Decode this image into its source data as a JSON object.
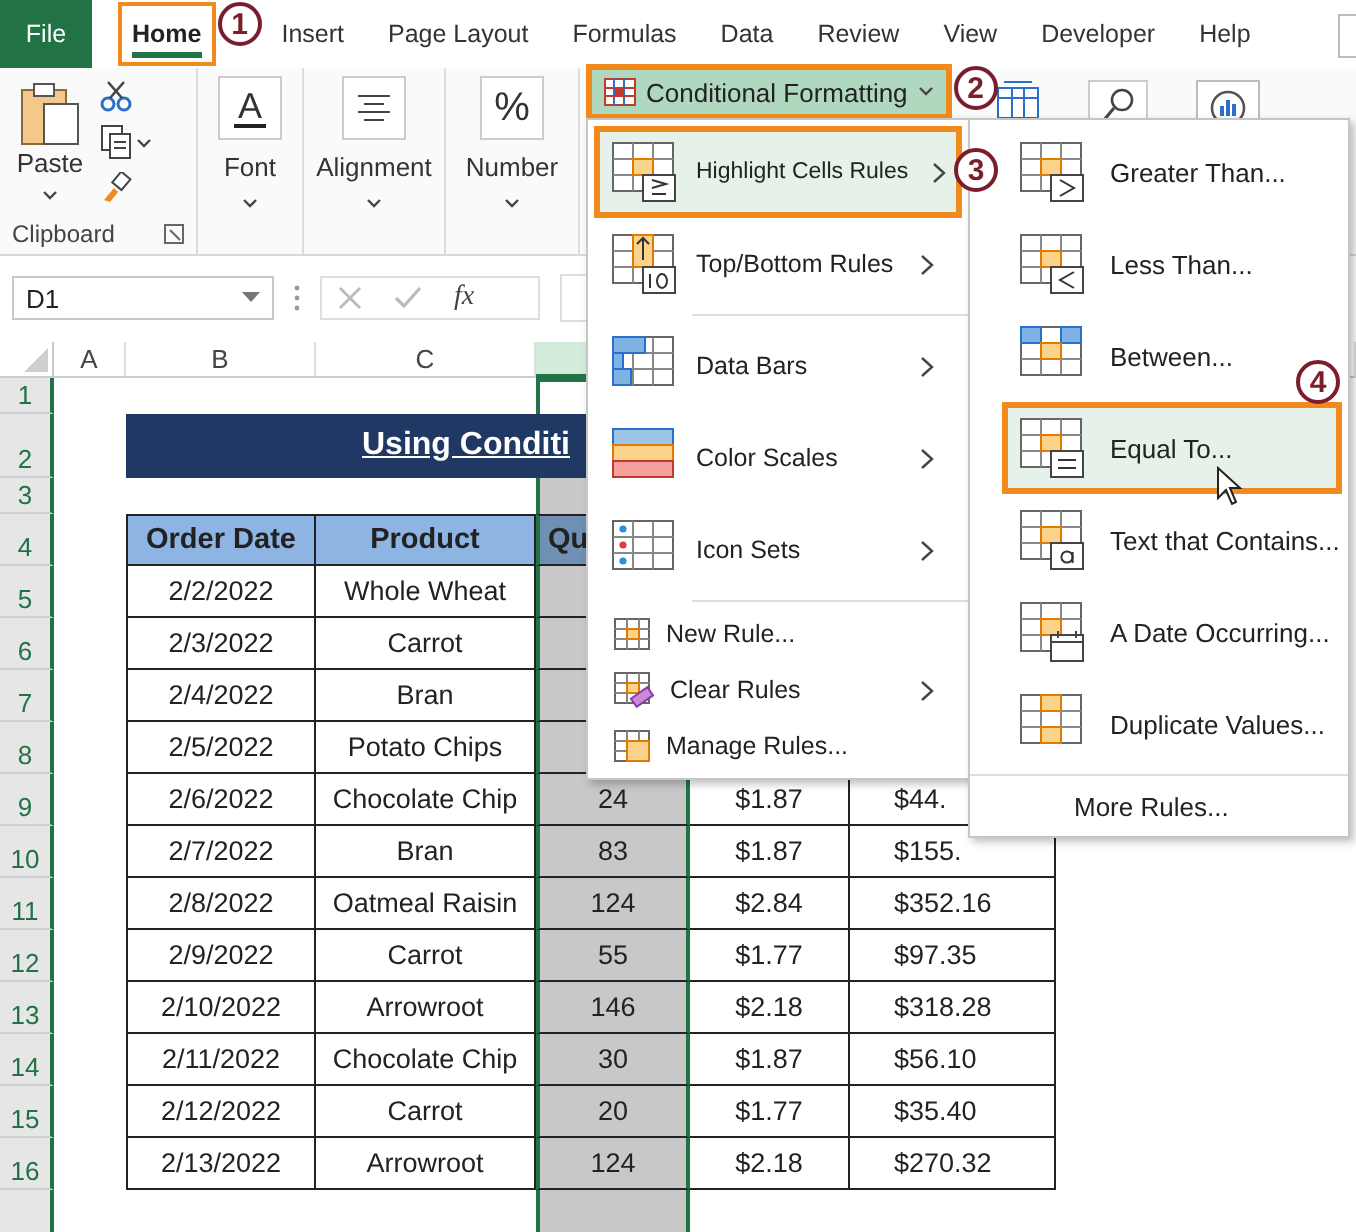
{
  "ribbon_tabs": [
    {
      "label": "File",
      "kind": "file",
      "selected": false,
      "highlighted": false
    },
    {
      "label": "Home",
      "kind": "tab",
      "selected": true,
      "highlighted": true,
      "callout": "1"
    },
    {
      "label": "Insert",
      "kind": "tab",
      "selected": false,
      "highlighted": false
    },
    {
      "label": "Page Layout",
      "kind": "tab",
      "selected": false,
      "highlighted": false
    },
    {
      "label": "Formulas",
      "kind": "tab",
      "selected": false,
      "highlighted": false
    },
    {
      "label": "Data",
      "kind": "tab",
      "selected": false,
      "highlighted": false
    },
    {
      "label": "Review",
      "kind": "tab",
      "selected": false,
      "highlighted": false
    },
    {
      "label": "View",
      "kind": "tab",
      "selected": false,
      "highlighted": false
    },
    {
      "label": "Developer",
      "kind": "tab",
      "selected": false,
      "highlighted": false
    },
    {
      "label": "Help",
      "kind": "tab",
      "selected": false,
      "highlighted": false
    }
  ],
  "ribbon_groups": [
    {
      "kind": "clipboard",
      "button": "Paste",
      "label": "Clipboard"
    },
    {
      "kind": "font",
      "glyph": "A",
      "button": "Font"
    },
    {
      "kind": "alignment",
      "button": "Alignment"
    },
    {
      "kind": "number",
      "glyph": "%",
      "button": "Number"
    }
  ],
  "conditional_formatting": {
    "label": "Conditional Formatting",
    "highlighted": true,
    "callout": "2"
  },
  "formula_bar": {
    "name_box": "D1",
    "function_glyph": "fx"
  },
  "sheet": {
    "column_letters": [
      {
        "label": "A",
        "selected": false
      },
      {
        "label": "B",
        "selected": false
      },
      {
        "label": "C",
        "selected": false
      },
      {
        "selected": true
      }
    ],
    "row_numbers": [
      "1",
      "2",
      "3",
      "4",
      "5",
      "6",
      "7",
      "8",
      "9",
      "10",
      "11",
      "12",
      "13",
      "14",
      "15",
      "16"
    ],
    "title": "Using Conditi",
    "table": {
      "headers": [
        "Order Date",
        "Product",
        "Qu"
      ],
      "rows": [
        [
          "2/2/2022",
          "Whole Wheat"
        ],
        [
          "2/3/2022",
          "Carrot"
        ],
        [
          "2/4/2022",
          "Bran"
        ],
        [
          "2/5/2022",
          "Potato Chips"
        ],
        [
          "2/6/2022",
          "Chocolate Chip",
          "24",
          "$1.87",
          "$44."
        ],
        [
          "2/7/2022",
          "Bran",
          "83",
          "$1.87",
          "$155."
        ],
        [
          "2/8/2022",
          "Oatmeal Raisin",
          "124",
          "$2.84",
          "$352.16"
        ],
        [
          "2/9/2022",
          "Carrot",
          "55",
          "$1.77",
          "$97.35"
        ],
        [
          "2/10/2022",
          "Arrowroot",
          "146",
          "$2.18",
          "$318.28"
        ],
        [
          "2/11/2022",
          "Chocolate Chip",
          "30",
          "$1.87",
          "$56.10"
        ],
        [
          "2/12/2022",
          "Carrot",
          "20",
          "$1.77",
          "$35.40"
        ],
        [
          "2/13/2022",
          "Arrowroot",
          "124",
          "$2.18",
          "$270.32"
        ]
      ]
    }
  },
  "menu": {
    "items": [
      {
        "kind": "highlight",
        "label": "Highlight Cells Rules",
        "submenu": true,
        "highlighted": true,
        "callout": "3"
      },
      {
        "kind": "topbottom",
        "label": "Top/Bottom Rules",
        "submenu": true,
        "highlighted": false
      },
      {
        "kind": "separator"
      },
      {
        "kind": "databars",
        "label": "Data Bars",
        "submenu": true,
        "highlighted": false
      },
      {
        "kind": "colorscales",
        "label": "Color Scales",
        "submenu": true,
        "highlighted": false
      },
      {
        "kind": "iconsets",
        "label": "Icon Sets",
        "submenu": true,
        "highlighted": false
      },
      {
        "kind": "separator"
      },
      {
        "kind": "newrule",
        "label": "New Rule...",
        "submenu": false,
        "highlighted": false
      },
      {
        "kind": "clearrules",
        "label": "Clear Rules",
        "submenu": true,
        "highlighted": false
      },
      {
        "kind": "managerules",
        "label": "Manage Rules...",
        "submenu": false,
        "highlighted": false
      }
    ]
  },
  "submenu": {
    "items": [
      {
        "kind": "greater",
        "label": "Greater Than...",
        "highlighted": false
      },
      {
        "kind": "less",
        "label": "Less Than...",
        "highlighted": false
      },
      {
        "kind": "between",
        "label": "Between...",
        "highlighted": false
      },
      {
        "kind": "equal",
        "label": "Equal To...",
        "highlighted": true,
        "callout": "4"
      },
      {
        "kind": "text",
        "label": "Text that Contains...",
        "highlighted": false
      },
      {
        "kind": "date",
        "label": "A Date Occurring...",
        "highlighted": false
      },
      {
        "kind": "duplicate",
        "label": "Duplicate Values...",
        "highlighted": false
      },
      {
        "kind": "separator"
      },
      {
        "kind": "more",
        "label": "More Rules...",
        "highlighted": false
      }
    ]
  }
}
